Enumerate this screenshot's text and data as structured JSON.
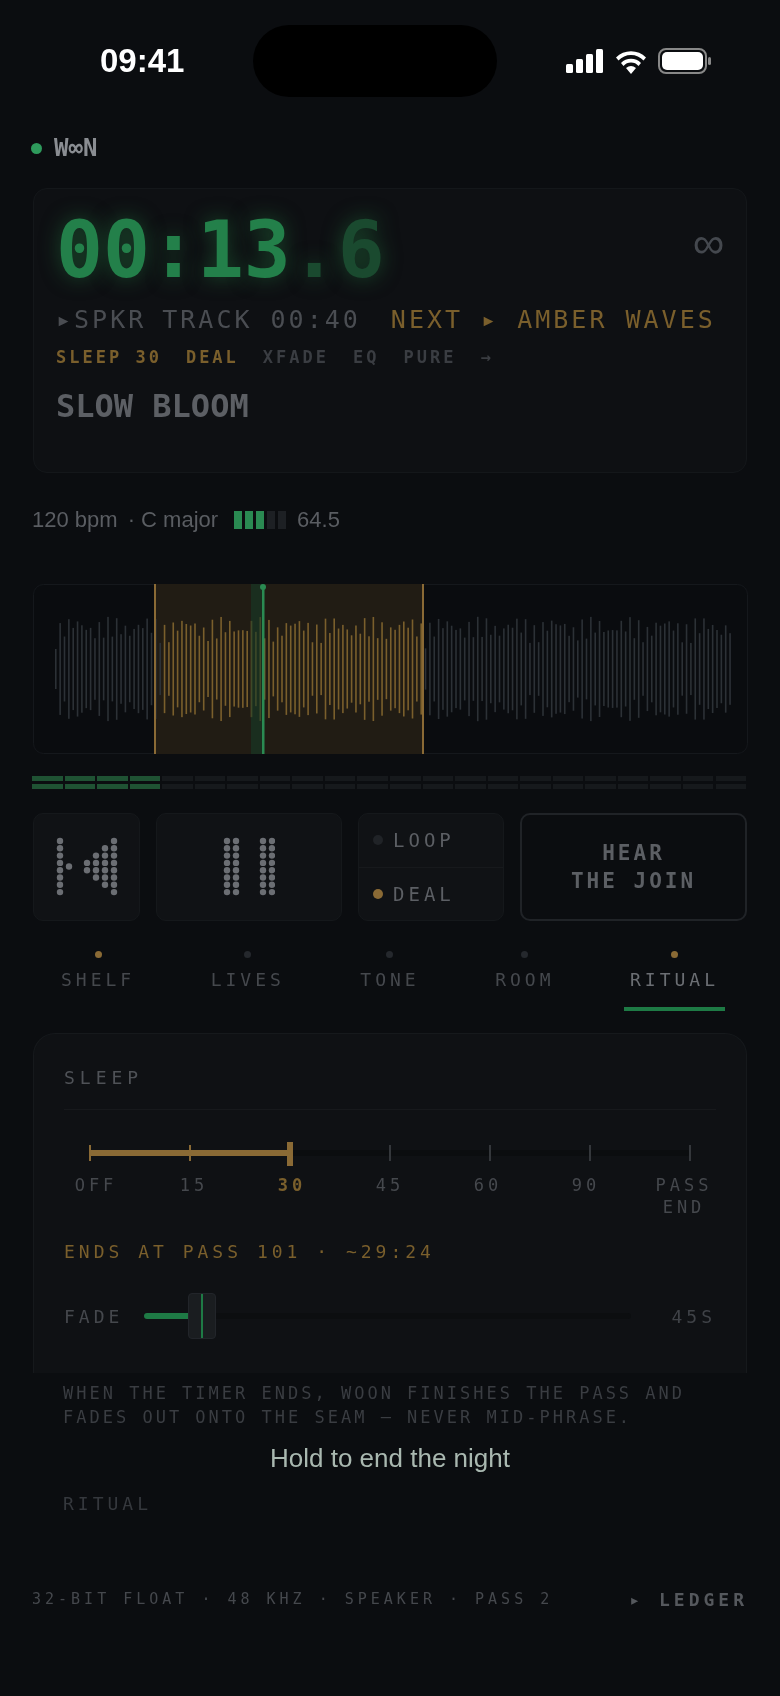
{
  "status_bar": {
    "time": "09:41"
  },
  "brand": {
    "name": "W∞N"
  },
  "now_playing": {
    "time": "00:13",
    "time_fraction": ".6",
    "loop_glyph": "∞",
    "source": "▸SPKR",
    "track": "TRACK 00:40",
    "next": "NEXT ▸ AMBER WAVES",
    "chips": [
      {
        "label": "SLEEP 30",
        "on": true
      },
      {
        "label": "DEAL",
        "on": true
      },
      {
        "label": "XFADE",
        "on": false
      },
      {
        "label": "EQ",
        "on": false
      },
      {
        "label": "PURE",
        "on": false
      },
      {
        "label": "→",
        "on": false
      }
    ],
    "title": "SLOW BLOOM"
  },
  "meta": {
    "tempo": "120 bpm",
    "key": "· C major",
    "energy": {
      "level": 0.6
    },
    "energy_value": "64.5"
  },
  "level_meter": {
    "level": 0.18
  },
  "controls": {
    "toggles": [
      {
        "label": "LOOP",
        "on": false
      },
      {
        "label": "DEAL",
        "on": true
      }
    ],
    "hear_button": "HEAR THE JOIN"
  },
  "tabs": [
    {
      "label": "SHELF",
      "selected": false,
      "color": "#8a6a35"
    },
    {
      "label": "LIVES",
      "selected": false,
      "color": "#25282d"
    },
    {
      "label": "TONE",
      "selected": false,
      "color": "#25282d"
    },
    {
      "label": "ROOM",
      "selected": false,
      "color": "#25282d"
    },
    {
      "label": "RITUAL",
      "selected": true,
      "color": "#8a6a35"
    }
  ],
  "sleep": {
    "heading": "SLEEP",
    "stops": [
      {
        "label": "OFF",
        "selected": false
      },
      {
        "label": "15",
        "selected": false
      },
      {
        "label": "30",
        "selected": true
      },
      {
        "label": "45",
        "selected": false
      },
      {
        "label": "60",
        "selected": false
      },
      {
        "label": "90",
        "selected": false
      },
      {
        "label": "PASS END",
        "selected": false
      }
    ],
    "slider": {
      "level": 0.333
    },
    "ends": "ENDS AT PASS 101 · ~29:24",
    "fade_label": "FADE",
    "fade": {
      "level": 0.12
    },
    "fade_value": "45S",
    "note": "WHEN THE TIMER ENDS, WOON FINISHES THE PASS AND FADES OUT ONTO THE SEAM — NEVER MID-PHRASE.",
    "next_heading": "RITUAL"
  },
  "hint": "Hold to end the night",
  "footer": {
    "info": "32-BIT FLOAT · 48 KHZ · SPEAKER · PASS 2",
    "link": "▸ LEDGER"
  }
}
